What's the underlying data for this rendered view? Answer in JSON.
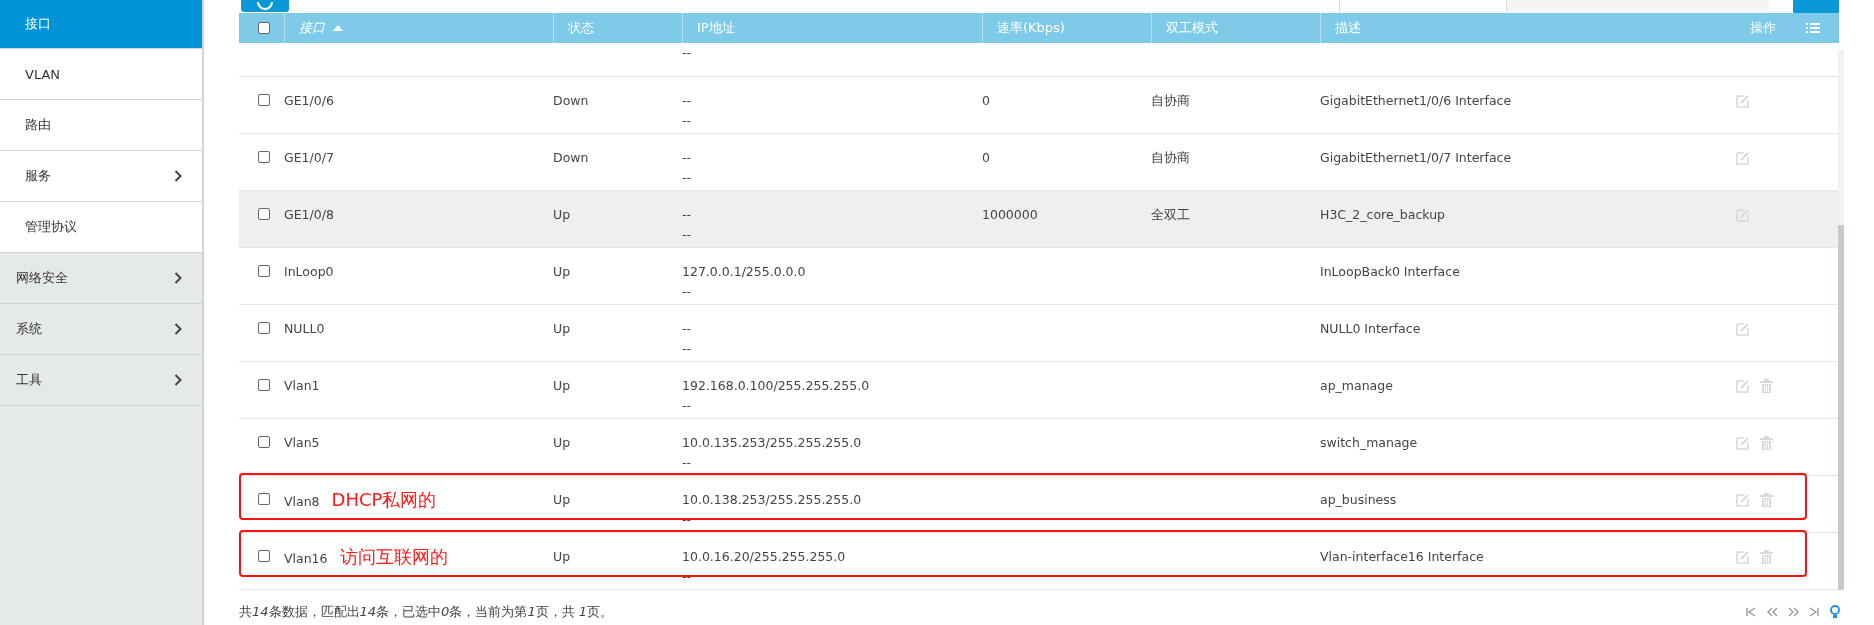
{
  "sidebar": {
    "items": [
      {
        "label": "接口",
        "kind": "sub",
        "selected": true,
        "expandable": false
      },
      {
        "label": "VLAN",
        "kind": "sub",
        "selected": false,
        "expandable": false
      },
      {
        "label": "路由",
        "kind": "sub",
        "selected": false,
        "expandable": false
      },
      {
        "label": "服务",
        "kind": "sub",
        "selected": false,
        "expandable": true
      },
      {
        "label": "管理协议",
        "kind": "sub",
        "selected": false,
        "expandable": false
      },
      {
        "label": "网络安全",
        "kind": "group",
        "selected": false,
        "expandable": true
      },
      {
        "label": "系统",
        "kind": "group",
        "selected": false,
        "expandable": true
      },
      {
        "label": "工具",
        "kind": "group",
        "selected": false,
        "expandable": true
      }
    ]
  },
  "table": {
    "columns": [
      {
        "label": "接口",
        "sorted": true
      },
      {
        "label": "状态",
        "sorted": false
      },
      {
        "label": "IP地址",
        "sorted": false
      },
      {
        "label": "速率(Kbps)",
        "sorted": false
      },
      {
        "label": "双工模式",
        "sorted": false
      },
      {
        "label": "描述",
        "sorted": false
      },
      {
        "label": "操作",
        "sorted": false
      }
    ],
    "rows": [
      {
        "kind": "partial",
        "ip": [
          "--"
        ]
      },
      {
        "kind": "full",
        "interface": "GE1/0/6",
        "status": "Down",
        "ip": [
          "--",
          "--"
        ],
        "speed": "0",
        "duplex": "自协商",
        "description": "GigabitEthernet1/0/6 Interface",
        "highlighted": false,
        "checked": false,
        "editable": true,
        "deletable": false
      },
      {
        "kind": "full",
        "interface": "GE1/0/7",
        "status": "Down",
        "ip": [
          "--",
          "--"
        ],
        "speed": "0",
        "duplex": "自协商",
        "description": "GigabitEthernet1/0/7 Interface",
        "highlighted": false,
        "checked": false,
        "editable": true,
        "deletable": false
      },
      {
        "kind": "full",
        "interface": "GE1/0/8",
        "status": "Up",
        "ip": [
          "--",
          "--"
        ],
        "speed": "1000000",
        "duplex": "全双工",
        "description": "H3C_2_core_backup",
        "highlighted": true,
        "checked": false,
        "editable": true,
        "deletable": false
      },
      {
        "kind": "full",
        "interface": "InLoop0",
        "status": "Up",
        "ip": [
          "127.0.0.1/255.0.0.0",
          "--"
        ],
        "description": "InLoopBack0 Interface",
        "highlighted": false,
        "checked": false,
        "editable": false,
        "deletable": false
      },
      {
        "kind": "full",
        "interface": "NULL0",
        "status": "Up",
        "ip": [
          "--",
          "--"
        ],
        "description": "NULL0 Interface",
        "highlighted": false,
        "checked": false,
        "editable": true,
        "deletable": false
      },
      {
        "kind": "full",
        "interface": "Vlan1",
        "status": "Up",
        "ip": [
          "192.168.0.100/255.255.255.0",
          "--"
        ],
        "description": "ap_manage",
        "highlighted": false,
        "checked": false,
        "editable": true,
        "deletable": true
      },
      {
        "kind": "full",
        "interface": "Vlan5",
        "status": "Up",
        "ip": [
          "10.0.135.253/255.255.255.0",
          "--"
        ],
        "description": "switch_manage",
        "highlighted": false,
        "checked": false,
        "editable": true,
        "deletable": true
      },
      {
        "kind": "full",
        "interface": "Vlan8",
        "annotation": "DHCP私网的",
        "status": "Up",
        "ip": [
          "10.0.138.253/255.255.255.0",
          "--"
        ],
        "description": "ap_business",
        "highlighted": false,
        "checked": false,
        "editable": true,
        "deletable": true
      },
      {
        "kind": "full",
        "interface": "Vlan16",
        "annotation": "访问互联网的",
        "status": "Up",
        "ip": [
          "10.0.16.20/255.255.255.0",
          "--"
        ],
        "description": "Vlan-interface16 Interface",
        "highlighted": false,
        "checked": false,
        "editable": true,
        "deletable": true
      }
    ]
  },
  "select_all": {
    "checked": false
  },
  "footer": {
    "summary": [
      {
        "text": "共",
        "italic": false
      },
      {
        "text": "14",
        "italic": true
      },
      {
        "text": "条数据，匹配出",
        "italic": false
      },
      {
        "text": "14",
        "italic": true
      },
      {
        "text": "条，已选中",
        "italic": false
      },
      {
        "text": "0",
        "italic": true
      },
      {
        "text": "条，当前为第",
        "italic": false
      },
      {
        "text": "1",
        "italic": true
      },
      {
        "text": "页，共 ",
        "italic": false
      },
      {
        "text": "1",
        "italic": true
      },
      {
        "text": "页。",
        "italic": false
      }
    ]
  }
}
